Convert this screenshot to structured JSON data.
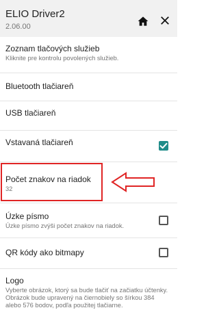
{
  "app_bar": {
    "title": "ELIO Driver2",
    "version": "2.06.00",
    "icons": {
      "home": "home-icon",
      "close": "close-icon"
    }
  },
  "settings": {
    "print_services": {
      "title": "Zoznam tlačových služieb",
      "summary": "Kliknite pre kontrolu povolených služieb."
    },
    "bluetooth": {
      "title": "Bluetooth tlačiareň"
    },
    "usb": {
      "title": "USB tlačiareň"
    },
    "builtin": {
      "title": "Vstavaná tlačiareň",
      "checked": true
    },
    "chars_per_line": {
      "title": "Počet znakov na riadok",
      "value": "32"
    },
    "narrow_font": {
      "title": "Úzke písmo",
      "summary": "Úzke písmo zvýši počet znakov na riadok.",
      "checked": false
    },
    "qr_bitmap": {
      "title": "QR kódy ako bitmapy",
      "checked": false
    },
    "logo": {
      "title": "Logo",
      "summary": "Vyberte obrázok, ktorý sa bude tlačiť na začiatku účtenky. Obrázok bude upravený na čiernobiely so šírkou 384 alebo 576 bodov, podľa použitej tlačiarne."
    }
  },
  "colors": {
    "checkbox_checked": "#1f8c89",
    "annotation_red": "#e02424",
    "app_bar_bg": "#f1f1f1"
  }
}
